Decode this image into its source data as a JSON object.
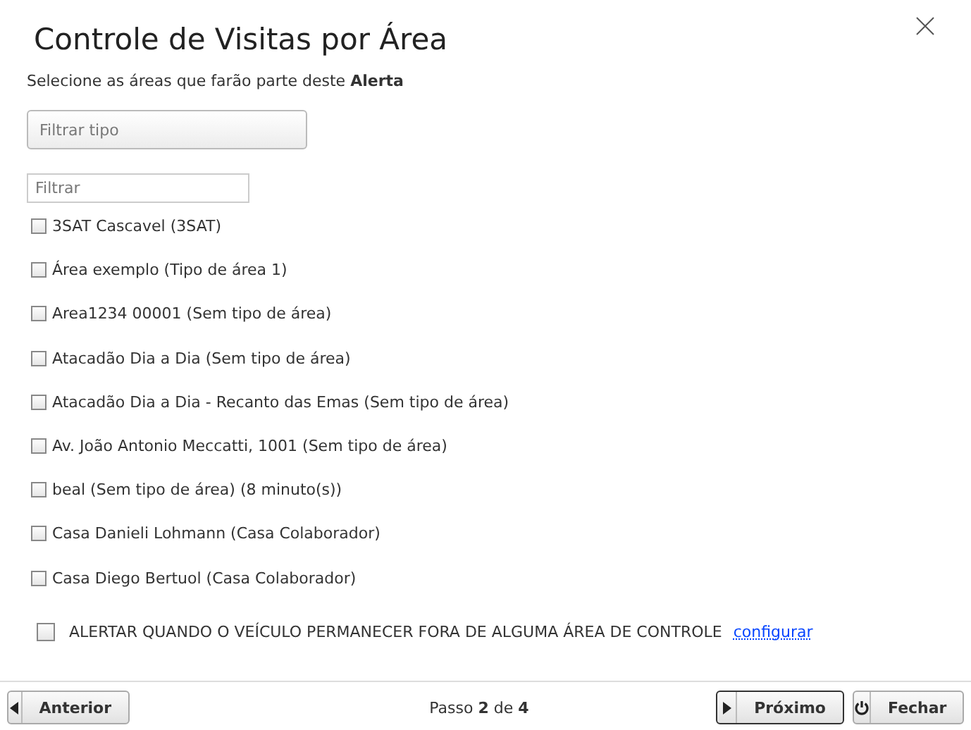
{
  "dialog": {
    "title": "Controle de Visitas por Área",
    "subtitle": "Selecione as áreas que farão parte deste **Alerta**"
  },
  "type_filter": {
    "placeholder": "Filtrar tipo"
  },
  "filter": {
    "placeholder": "Filtrar"
  },
  "areas": [
    {
      "label": "3SAT Cascavel (3SAT)",
      "checked": false
    },
    {
      "label": "Área exemplo (Tipo de área 1)",
      "checked": false
    },
    {
      "label": "Area1234 00001 (Sem tipo de área)",
      "checked": false
    },
    {
      "label": "Atacadão Dia a Dia (Sem tipo de área)",
      "checked": false
    },
    {
      "label": "Atacadão Dia a Dia - Recanto das Emas (Sem tipo de área)",
      "checked": false
    },
    {
      "label": "Av. João Antonio Meccatti, 1001 (Sem tipo de área)",
      "checked": false
    },
    {
      "label": "beal (Sem tipo de área) (8 minuto(s))",
      "checked": false
    },
    {
      "label": "Casa Danieli Lohmann (Casa Colaborador)",
      "checked": false
    },
    {
      "label": "Casa Diego Bertuol (Casa Colaborador)",
      "checked": false
    }
  ],
  "outside_alert": {
    "label": "ALERTAR QUANDO O VEÍCULO PERMANECER FORA DE ALGUMA ÁREA DE CONTROLE",
    "checked": false,
    "link": "configurar"
  },
  "footer": {
    "previous": "Anterior",
    "step": "Passo **2** de **4**",
    "next": "Próximo",
    "close": "Fechar"
  }
}
